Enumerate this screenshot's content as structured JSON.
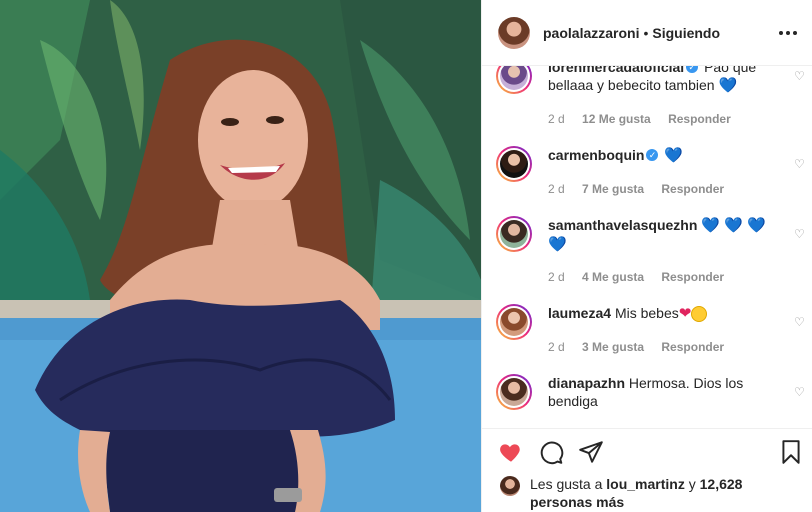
{
  "header": {
    "username": "paolalazzaroni",
    "separator": "•",
    "follow_status": "Siguiendo"
  },
  "comments": [
    {
      "username": "lorenmercadaloficial",
      "verified": true,
      "text": "Pao que bellaaa y bebecito tambien",
      "emoji": "💙",
      "age": "2 d",
      "likes": "12 Me gusta",
      "reply": "Responder"
    },
    {
      "username": "carmenboquin",
      "verified": true,
      "text": "",
      "emoji": "💙",
      "age": "2 d",
      "likes": "7 Me gusta",
      "reply": "Responder"
    },
    {
      "username": "samanthavelasquezhn",
      "verified": false,
      "text": "",
      "emoji": "💙 💙 💙 💙",
      "age": "2 d",
      "likes": "4 Me gusta",
      "reply": "Responder"
    },
    {
      "username": "laumeza4",
      "verified": false,
      "text": "Mis bebes",
      "emoji": "❤",
      "age": "2 d",
      "likes": "3 Me gusta",
      "reply": "Responder"
    },
    {
      "username": "dianapazhn",
      "verified": false,
      "text": "Hermosa. Dios los bendiga",
      "emoji": "",
      "age": "",
      "likes": "",
      "reply": ""
    }
  ],
  "likes": {
    "prefix": "Les gusta a",
    "user": "lou_martinz",
    "joiner": "y",
    "count": "12,628 personas más"
  },
  "icons": {
    "like": "heart-filled-icon",
    "comment": "comment-bubble-icon",
    "share": "paper-plane-icon",
    "save": "bookmark-icon",
    "more": "more-dots-icon"
  },
  "colors": {
    "like_red": "#ed4956",
    "verified_blue": "#3897f0",
    "text": "#262626",
    "muted": "#8e8e8e"
  }
}
